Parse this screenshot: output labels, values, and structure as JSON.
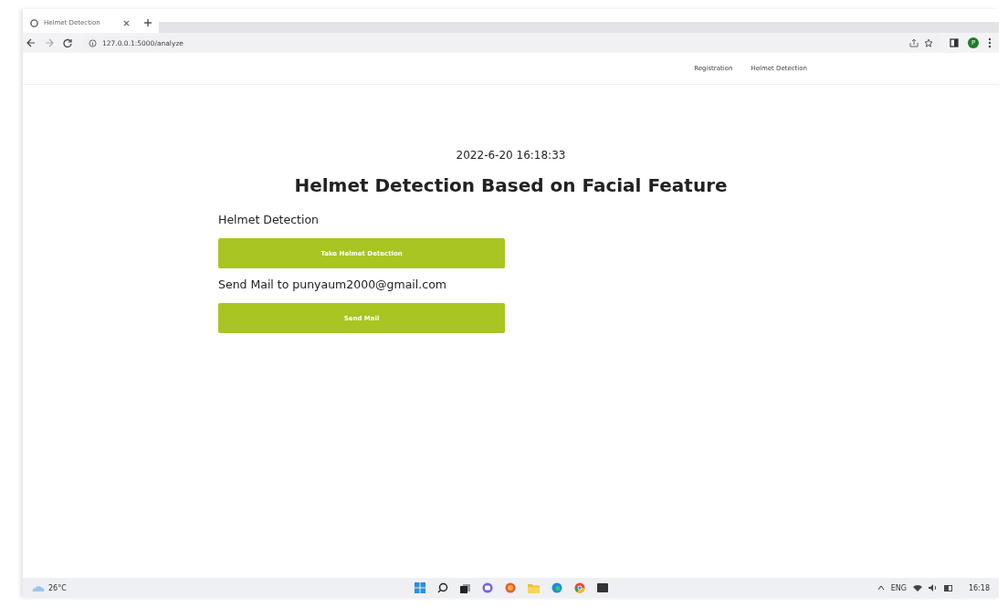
{
  "browser": {
    "tab_title": "Helmet Detection",
    "url": "127.0.0.1:5000/analyze",
    "profile_initial": "P"
  },
  "nav": {
    "links": [
      {
        "label": "Registration"
      },
      {
        "label": "Helmet Detection"
      }
    ]
  },
  "page": {
    "timestamp": "2022-6-20 16:18:33",
    "title": "Helmet Detection Based on Facial Feature",
    "sections": [
      {
        "heading": "Helmet Detection",
        "button": "Take Helmet Detection"
      },
      {
        "heading": "Send Mail to punyaum2000@gmail.com",
        "button": "Send Mail"
      }
    ]
  },
  "taskbar": {
    "weather": "26°C",
    "language": "ENG",
    "time": "16:18"
  }
}
